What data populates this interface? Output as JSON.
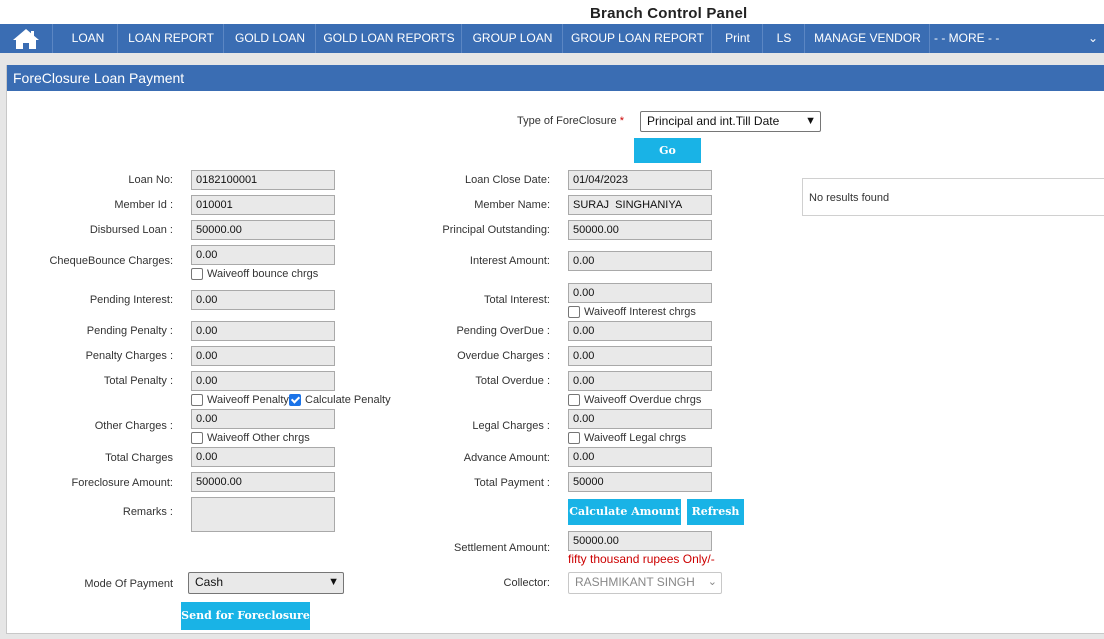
{
  "header": {
    "title": "Branch Control Panel"
  },
  "nav": {
    "items": [
      "LOAN",
      "LOAN REPORT",
      "GOLD LOAN",
      "GOLD LOAN REPORTS",
      "GROUP LOAN",
      "GROUP LOAN REPORT",
      "Print",
      "LS",
      "MANAGE VENDOR"
    ],
    "more": "- - MORE - -"
  },
  "section": {
    "title": "ForeClosure Loan Payment"
  },
  "foreclosure": {
    "type_label": "Type of ForeClosure",
    "required_mark": "*",
    "type_value": "Principal and int.Till Date",
    "go": "Go"
  },
  "results": {
    "empty": "No results found"
  },
  "left": {
    "loan_no": {
      "label": "Loan No:",
      "value": "0182100001"
    },
    "member_id": {
      "label": "Member Id :",
      "value": "010001"
    },
    "disbursed_loan": {
      "label": "Disbursed Loan :",
      "value": "50000.00"
    },
    "cheque_bounce": {
      "label": "ChequeBounce Charges:",
      "value": "0.00",
      "waive": "Waiveoff bounce chrgs"
    },
    "pending_interest": {
      "label": "Pending Interest:",
      "value": "0.00"
    },
    "pending_penalty": {
      "label": "Pending Penalty :",
      "value": "0.00"
    },
    "penalty_charges": {
      "label": "Penalty Charges :",
      "value": "0.00"
    },
    "total_penalty": {
      "label": "Total Penalty :",
      "value": "0.00",
      "waive": "Waiveoff Penalty",
      "calc": "Calculate Penalty"
    },
    "other_charges": {
      "label": "Other Charges :",
      "value": "0.00",
      "waive": "Waiveoff Other chrgs"
    },
    "total_charges": {
      "label": "Total Charges",
      "value": "0.00"
    },
    "foreclosure_amount": {
      "label": "Foreclosure Amount:",
      "value": "50000.00"
    },
    "remarks": {
      "label": "Remarks :",
      "value": ""
    },
    "mode_of_payment": {
      "label": "Mode Of Payment",
      "value": "Cash"
    },
    "send": "Send for Foreclosure"
  },
  "right": {
    "loan_close_date": {
      "label": "Loan Close Date:",
      "value": "01/04/2023"
    },
    "member_name": {
      "label": "Member Name:",
      "value": "SURAJ  SINGHANIYA"
    },
    "principal_outstanding": {
      "label": "Principal Outstanding:",
      "value": "50000.00"
    },
    "interest_amount": {
      "label": "Interest Amount:",
      "value": "0.00"
    },
    "total_interest": {
      "label": "Total Interest:",
      "value": "0.00",
      "waive": "Waiveoff Interest chrgs"
    },
    "pending_overdue": {
      "label": "Pending OverDue :",
      "value": "0.00"
    },
    "overdue_charges": {
      "label": "Overdue Charges :",
      "value": "0.00"
    },
    "total_overdue": {
      "label": "Total Overdue :",
      "value": "0.00",
      "waive": "Waiveoff Overdue chrgs"
    },
    "legal_charges": {
      "label": "Legal Charges :",
      "value": "0.00",
      "waive": "Waiveoff Legal chrgs"
    },
    "advance_amount": {
      "label": "Advance Amount:",
      "value": "0.00"
    },
    "total_payment": {
      "label": "Total Payment :",
      "value": "50000"
    },
    "calculate": "Calculate Amount",
    "refresh": "Refresh",
    "settlement_amount": {
      "label": "Settlement Amount:",
      "value": "50000.00"
    },
    "amount_words": "fifty thousand rupees Only/-",
    "collector": {
      "label": "Collector:",
      "value": "RASHMIKANT SINGH"
    }
  },
  "colors": {
    "nav": "#3a6db3",
    "button": "#19b3e6",
    "words": "#cc0000"
  },
  "icons": {
    "home": "home-icon",
    "dropdown": "chevron-down-icon"
  }
}
